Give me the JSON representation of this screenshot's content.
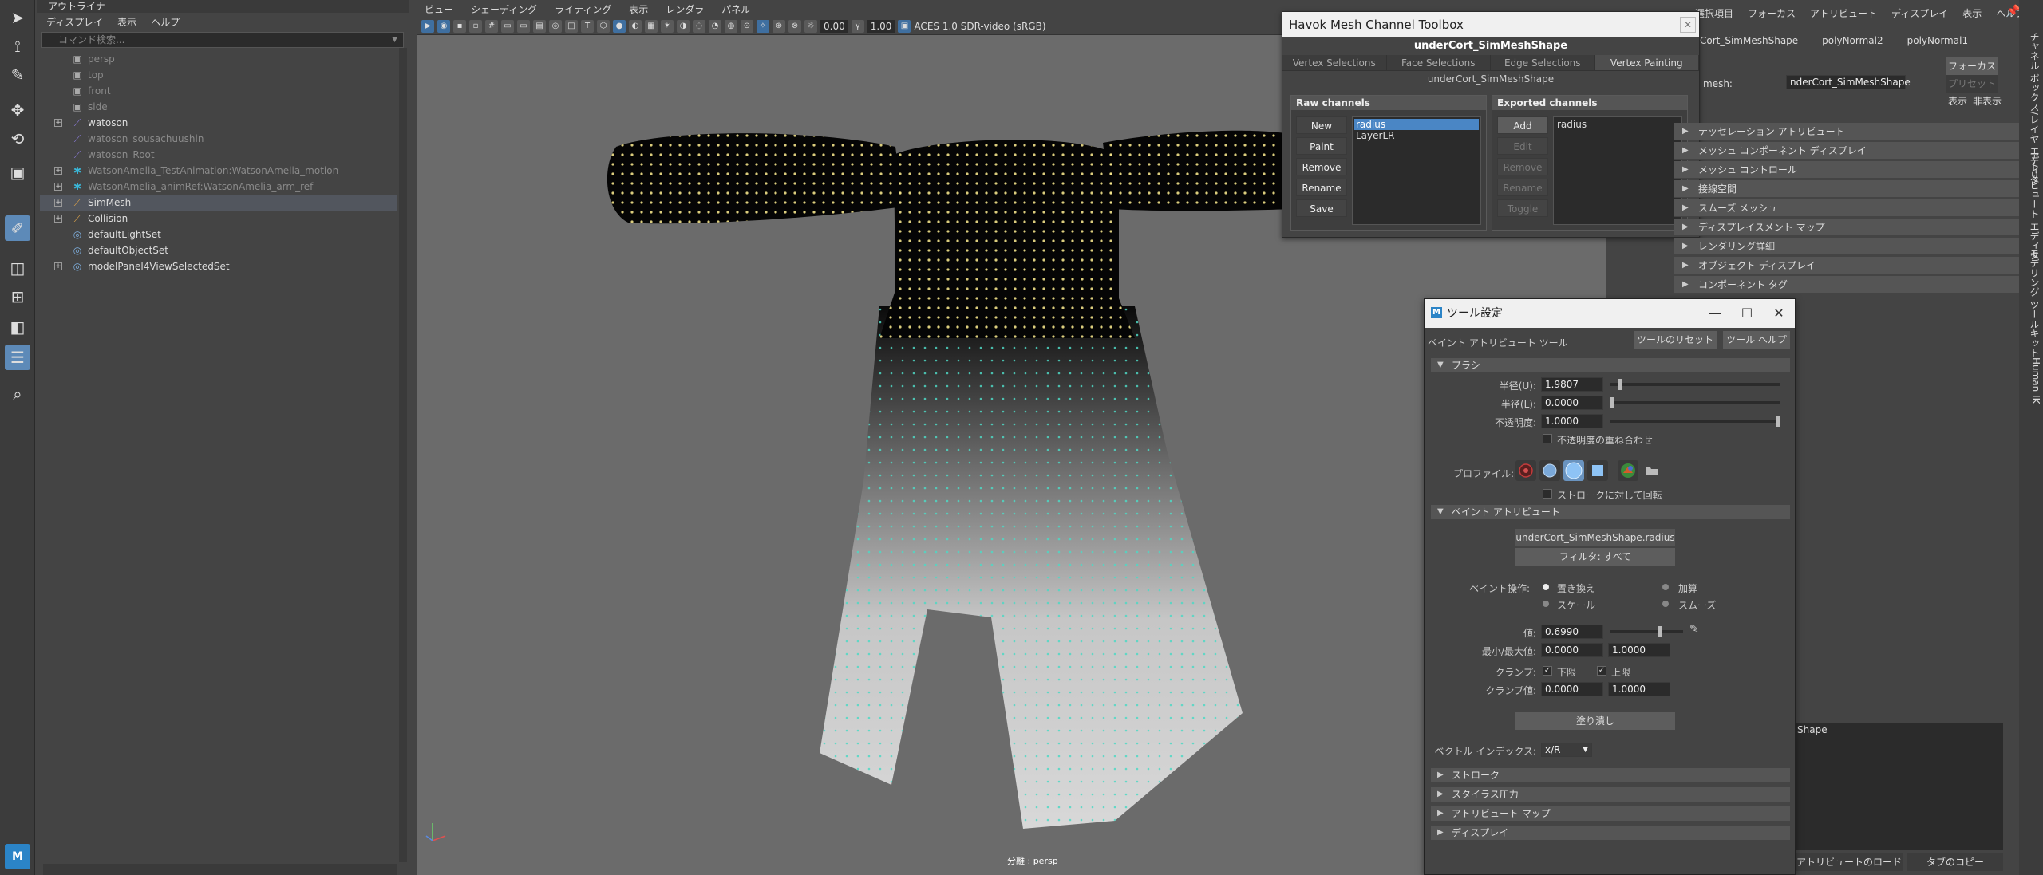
{
  "outliner": {
    "title": "アウトライナ",
    "menu": [
      "ディスプレイ",
      "表示",
      "ヘルプ"
    ],
    "search_placeholder": "コマンド検索...",
    "items": [
      {
        "label": "persp",
        "dim": true,
        "icon": "camera-icon"
      },
      {
        "label": "top",
        "dim": true,
        "icon": "camera-icon"
      },
      {
        "label": "front",
        "dim": true,
        "icon": "camera-icon"
      },
      {
        "label": "side",
        "dim": true,
        "icon": "camera-icon"
      },
      {
        "label": "watoson",
        "dim": false,
        "icon": "joint-icon"
      },
      {
        "label": "watoson_sousachuushin",
        "dim": true,
        "icon": "joint-icon"
      },
      {
        "label": "watoson_Root",
        "dim": true,
        "icon": "joint-icon"
      },
      {
        "label": "WatsonAmelia_TestAnimation:WatsonAmelia_motion",
        "dim": true,
        "icon": "locator-icon"
      },
      {
        "label": "WatsonAmelia_animRef:WatsonAmelia_arm_ref",
        "dim": true,
        "icon": "locator-icon"
      },
      {
        "label": "SimMesh",
        "dim": false,
        "icon": "mesh-icon"
      },
      {
        "label": "Collision",
        "dim": false,
        "icon": "mesh-icon"
      },
      {
        "label": "defaultLightSet",
        "dim": false,
        "icon": "set-icon"
      },
      {
        "label": "defaultObjectSet",
        "dim": false,
        "icon": "set-icon"
      },
      {
        "label": "modelPanel4ViewSelectedSet",
        "dim": false,
        "icon": "set-icon"
      }
    ]
  },
  "viewport": {
    "menu": [
      "ビュー",
      "シェーディング",
      "ライティング",
      "表示",
      "レンダラ",
      "パネル"
    ],
    "exposure": "0.00",
    "gamma": "1.00",
    "colorspace": "ACES 1.0 SDR-video (sRGB)",
    "camera_label": "分離 : persp"
  },
  "havok": {
    "title": "Havok Mesh Channel Toolbox",
    "shape": "underCort_SimMeshShape",
    "tabs": [
      "Vertex Selections",
      "Face Selections",
      "Edge Selections",
      "Vertex Painting"
    ],
    "active_tab": "Vertex Painting",
    "subtitle": "underCort_SimMeshShape",
    "raw": {
      "title": "Raw channels",
      "buttons": [
        "New",
        "Paint",
        "Remove",
        "Rename",
        "Save"
      ],
      "list": [
        "radius",
        "LayerLR"
      ]
    },
    "exported": {
      "title": "Exported channels",
      "buttons": [
        "Add",
        "Edit",
        "Remove",
        "Rename",
        "Toggle"
      ],
      "list": [
        "radius"
      ]
    }
  },
  "attr": {
    "menu": [
      "選択項目",
      "フォーカス",
      "アトリビュート",
      "ディスプレイ",
      "表示",
      "ヘルプ"
    ],
    "tabs": [
      "Cort_SimMeshShape",
      "polyNormal2",
      "polyNormal1"
    ],
    "focus_btn": "フォーカス",
    "preset_btn": "プリセット",
    "show_btn": "表示",
    "hide_btn": "非表示",
    "mesh_label": "mesh:",
    "mesh_value": "nderCort_SimMeshShape",
    "sections": [
      "テッセレーション アトリビュート",
      "メッシュ コンポーネント ディスプレイ",
      "メッシュ コントロール",
      "接線空間",
      "スムーズ メッシュ",
      "ディスプレイスメント マップ",
      "レンダリング詳細",
      "オブジェクト ディスプレイ",
      "コンポーネント タグ"
    ],
    "notes_label": "Shape",
    "load_btn": "アトリビュートのロード",
    "copy_btn": "タブのコピー",
    "side_tabs": [
      "チャネル ボックス/レイヤ エディタ",
      "アトリビュート エディタ",
      "モデリング ツールキット",
      "Human IK"
    ]
  },
  "tool": {
    "title": "ツール設定",
    "tool_name": "ペイント アトリビュート ツール",
    "reset_btn": "ツールのリセット",
    "help_btn": "ツール ヘルプ",
    "brush_header": "ブラシ",
    "radius_u_label": "半径(U):",
    "radius_u": "1.9807",
    "radius_l_label": "半径(L):",
    "radius_l": "0.0000",
    "opacity_label": "不透明度:",
    "opacity": "1.0000",
    "accumulate_label": "不透明度の重ね合わせ",
    "profile_label": "プロファイル:",
    "rotate_label": "ストロークに対して回転",
    "paint_header": "ペイント アトリビュート",
    "attr_btn": "underCort_SimMeshShape.radius",
    "filter_btn": "フィルタ: すべて",
    "op_label": "ペイント操作:",
    "ops": [
      "置き換え",
      "加算",
      "スケール",
      "スムーズ"
    ],
    "value_label": "値:",
    "value": "0.6990",
    "value_frac": 0.699,
    "minmax_label": "最小/最大値:",
    "min": "0.0000",
    "max": "1.0000",
    "clamp_label": "クランプ:",
    "clamp_lower": "下限",
    "clamp_upper": "上限",
    "clampval_label": "クランプ値:",
    "clamp_min": "0.0000",
    "clamp_max": "1.0000",
    "flood_btn": "塗り潰し",
    "vector_label": "ベクトル インデックス:",
    "vector_value": "x/R",
    "footer_sections": [
      "ストローク",
      "スタイラス圧力",
      "アトリビュート マップ",
      "ディスプレイ"
    ]
  }
}
